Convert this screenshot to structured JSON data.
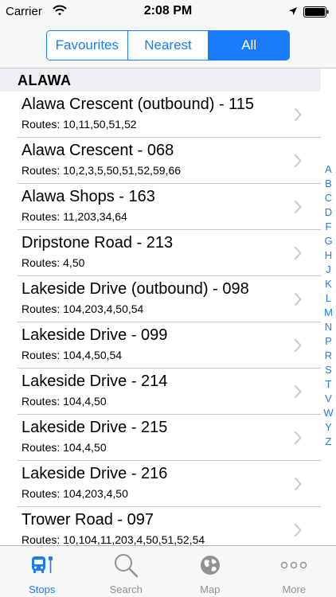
{
  "status_bar": {
    "carrier": "Carrier",
    "time": "2:08 PM"
  },
  "segments": [
    {
      "label": "Favourites",
      "active": false
    },
    {
      "label": "Nearest",
      "active": false
    },
    {
      "label": "All",
      "active": true
    }
  ],
  "section_title": "ALAWA",
  "stops": [
    {
      "title": "Alawa Crescent (outbound) - 115",
      "routes": "Routes: 10,11,50,51,52"
    },
    {
      "title": "Alawa Crescent - 068",
      "routes": "Routes: 10,2,3,5,50,51,52,59,66"
    },
    {
      "title": "Alawa Shops - 163",
      "routes": "Routes: 11,203,34,64"
    },
    {
      "title": "Dripstone Road - 213",
      "routes": "Routes: 4,50"
    },
    {
      "title": "Lakeside Drive (outbound) - 098",
      "routes": "Routes: 104,203,4,50,54"
    },
    {
      "title": "Lakeside Drive - 099",
      "routes": "Routes: 104,4,50,54"
    },
    {
      "title": "Lakeside Drive - 214",
      "routes": "Routes: 104,4,50"
    },
    {
      "title": "Lakeside Drive - 215",
      "routes": "Routes: 104,4,50"
    },
    {
      "title": "Lakeside Drive - 216",
      "routes": "Routes: 104,203,4,50"
    },
    {
      "title": "Trower Road - 097",
      "routes": "Routes: 10,104,11,203,4,50,51,52,54"
    }
  ],
  "index_letters": [
    "A",
    "B",
    "C",
    "D",
    "F",
    "G",
    "H",
    "J",
    "K",
    "L",
    "M",
    "N",
    "P",
    "R",
    "S",
    "T",
    "V",
    "W",
    "Y",
    "Z"
  ],
  "tabs": [
    {
      "label": "Stops",
      "icon": "bus-icon",
      "active": true
    },
    {
      "label": "Search",
      "icon": "magnifier-icon",
      "active": false
    },
    {
      "label": "Map",
      "icon": "globe-icon",
      "active": false
    },
    {
      "label": "More",
      "icon": "more-dots-icon",
      "active": false
    }
  ],
  "colors": {
    "accent": "#1a7cfa",
    "inactive_tab": "#929292",
    "section_bg": "#efeff4"
  }
}
